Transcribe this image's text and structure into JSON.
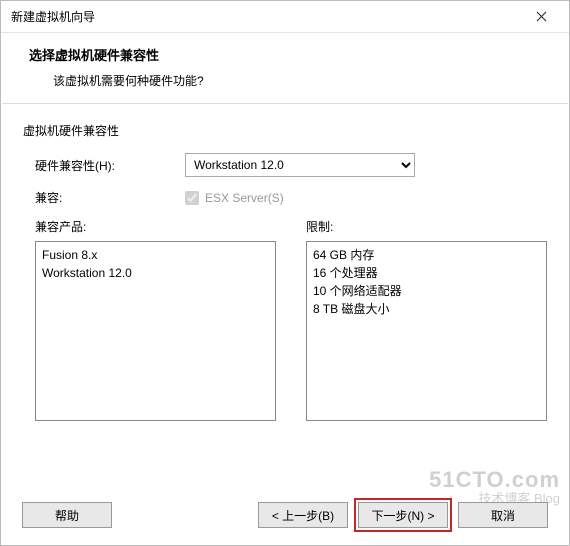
{
  "window": {
    "title": "新建虚拟机向导"
  },
  "header": {
    "main_title": "选择虚拟机硬件兼容性",
    "subtitle": "该虚拟机需要何种硬件功能?"
  },
  "section": {
    "legend": "虚拟机硬件兼容性"
  },
  "form": {
    "hw_compat_label": "硬件兼容性(H):",
    "hw_compat_value": "Workstation 12.0",
    "compat_label": "兼容:",
    "esx_label": "ESX Server(S)",
    "esx_checked": true
  },
  "lists": {
    "products_label": "兼容产品:",
    "products": [
      "Fusion 8.x",
      "Workstation 12.0"
    ],
    "limits_label": "限制:",
    "limits": [
      "64 GB 内存",
      "16 个处理器",
      "10 个网络适配器",
      "8 TB 磁盘大小"
    ]
  },
  "buttons": {
    "help": "帮助",
    "back": "< 上一步(B)",
    "next": "下一步(N) >",
    "cancel": "取消"
  },
  "watermark": {
    "line1": "51CTO.com",
    "line2": "技术博客 Blog"
  }
}
